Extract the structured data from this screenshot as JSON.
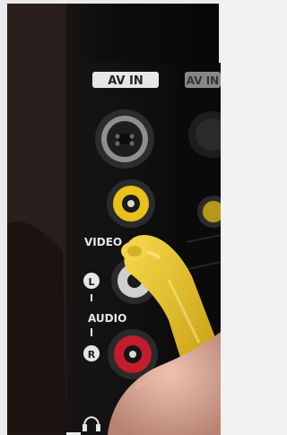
{
  "photo": {
    "labels": {
      "av_in": "AV IN",
      "av_in_side": "AV IN",
      "video": "VIDEO",
      "left": "L",
      "audio": "AUDIO",
      "right": "R"
    },
    "colors": {
      "panel": "#121212",
      "video_jack": "#e8c21a",
      "red_jack": "#c21d2b",
      "cable": "#e5c11b",
      "skin": "#d8a38f"
    }
  }
}
